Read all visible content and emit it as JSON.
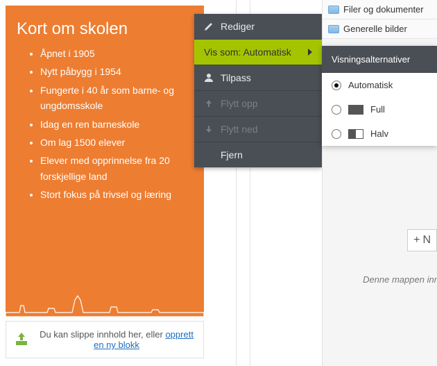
{
  "card": {
    "title": "Kort om skolen",
    "bullets": [
      "Åpnet i 1905",
      "Nytt påbygg i 1954",
      "Fungerte i 40 år som barne- og ungdomsskole",
      "Idag en ren barneskole",
      "Om lag 1500 elever",
      "Elever med opprinnelse fra 20 forskjellige land",
      "Stort fokus på trivsel og læring"
    ]
  },
  "dropbar": {
    "text_before": "Du kan slippe innhold her, eller ",
    "link": "opprett en ny blokk"
  },
  "context_menu": {
    "edit": "Rediger",
    "view_as": "Vis som: Automatisk",
    "customize": "Tilpass",
    "move_up": "Flytt opp",
    "move_down": "Flytt ned",
    "remove": "Fjern"
  },
  "sidebar": {
    "folders": [
      "Filer og dokumenter",
      "Generelle bilder"
    ],
    "options_header": "Visningsalternativer",
    "options": {
      "auto": "Automatisk",
      "full": "Full",
      "half": "Halv"
    },
    "selected": "auto",
    "add_label": "N",
    "empty_text": "Denne mappen inn"
  }
}
